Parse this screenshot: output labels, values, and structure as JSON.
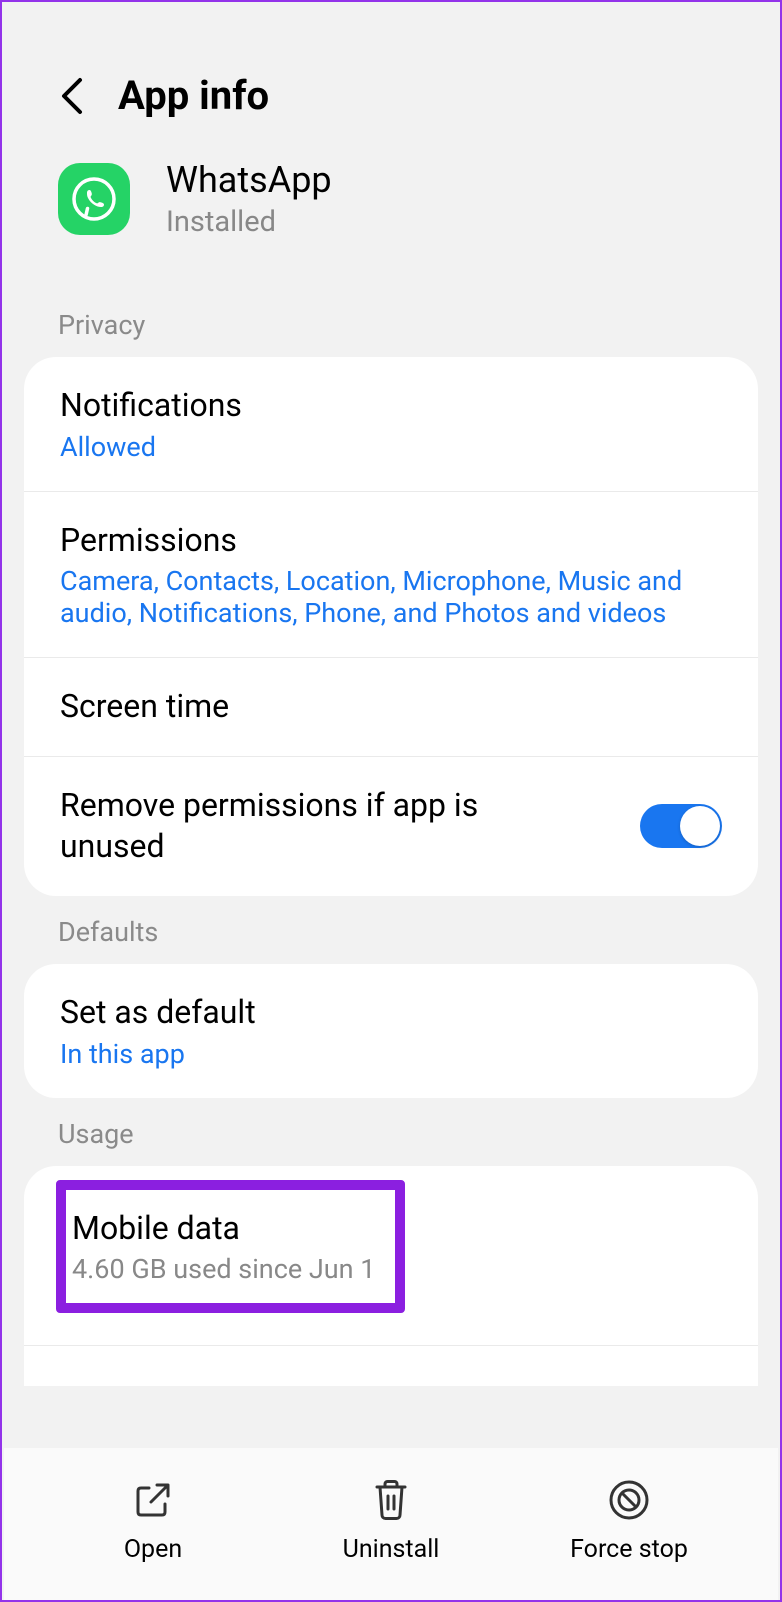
{
  "header": {
    "title": "App info"
  },
  "app": {
    "name": "WhatsApp",
    "status": "Installed"
  },
  "sections": {
    "privacy": {
      "label": "Privacy",
      "notifications": {
        "title": "Notifications",
        "sub": "Allowed"
      },
      "permissions": {
        "title": "Permissions",
        "sub": "Camera, Contacts, Location, Microphone, Music and audio, Notifications, Phone, and Photos and videos"
      },
      "screen_time": {
        "title": "Screen time"
      },
      "remove_perms": {
        "title": "Remove permissions if app is unused",
        "enabled": true
      }
    },
    "defaults": {
      "label": "Defaults",
      "set_default": {
        "title": "Set as default",
        "sub": "In this app"
      }
    },
    "usage": {
      "label": "Usage",
      "mobile_data": {
        "title": "Mobile data",
        "sub": "4.60 GB used since Jun 1"
      }
    }
  },
  "bottom": {
    "open": "Open",
    "uninstall": "Uninstall",
    "force_stop": "Force stop"
  }
}
